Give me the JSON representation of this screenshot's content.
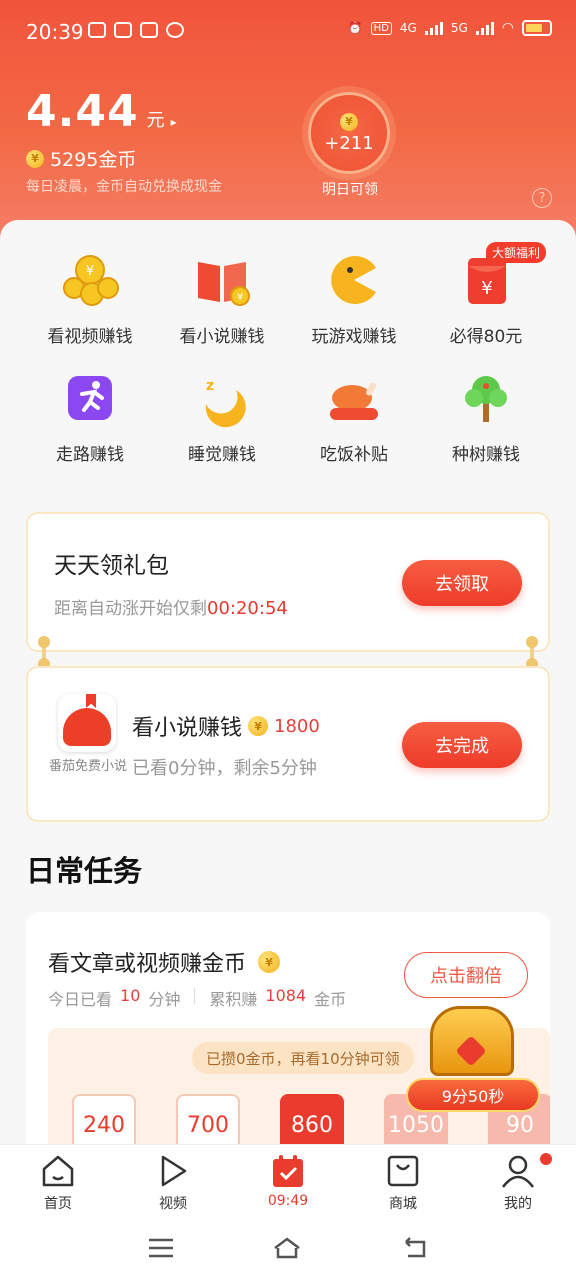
{
  "status_bar": {
    "time": "20:39",
    "network_a": "4G",
    "network_b": "5G",
    "hd": "HD"
  },
  "wallet": {
    "amount": "4.44",
    "unit": "元",
    "arrow": "▸",
    "coins": "5295金币",
    "note": "每日凌晨，金币自动兑换成现金",
    "tomorrow_bonus": "+211",
    "tomorrow_label": "明日可领",
    "help": "?"
  },
  "grid": [
    {
      "label": "看视频赚钱",
      "icon": "coin-pile-icon"
    },
    {
      "label": "看小说赚钱",
      "icon": "book-icon"
    },
    {
      "label": "玩游戏赚钱",
      "icon": "pacman-icon"
    },
    {
      "label": "必得80元",
      "icon": "red-envelope-icon"
    },
    {
      "label": "走路赚钱",
      "icon": "running-icon"
    },
    {
      "label": "睡觉赚钱",
      "icon": "moon-icon"
    },
    {
      "label": "吃饭补贴",
      "icon": "roast-chicken-icon"
    },
    {
      "label": "种树赚钱",
      "icon": "tree-icon"
    }
  ],
  "grid_badge": "大额福利",
  "gift": {
    "title": "天天领礼包",
    "countdown_prefix": "距离自动涨开始仅剩",
    "countdown": "00:20:54",
    "button": "去领取"
  },
  "novel_task": {
    "app_name": "番茄免费小说",
    "title": "看小说赚钱",
    "reward": "1800",
    "progress": "已看0分钟，剩余5分钟",
    "button": "去完成"
  },
  "daily": {
    "section_title": "日常任务",
    "title": "看文章或视频赚金币",
    "today_prefix": "今日已看",
    "today_value": "10",
    "today_unit": "分钟",
    "total_prefix": "累积赚",
    "total_value": "1084",
    "total_unit": "金币",
    "double_button": "点击翻倍",
    "tooltip": "已攒0金币，再看10分钟可领",
    "slots": [
      "240",
      "700",
      "860",
      "1050",
      "90"
    ],
    "chest_timer": "9分50秒"
  },
  "tabs": [
    {
      "label": "首页",
      "icon": "home-icon"
    },
    {
      "label": "视频",
      "icon": "play-icon"
    },
    {
      "label": "09:49",
      "icon": "calendar-check-icon"
    },
    {
      "label": "商城",
      "icon": "shopping-bag-icon"
    },
    {
      "label": "我的",
      "icon": "user-icon"
    }
  ],
  "colors": {
    "accent": "#ea3c2e",
    "header": "#f1543c",
    "coin": "#f3b11a"
  }
}
